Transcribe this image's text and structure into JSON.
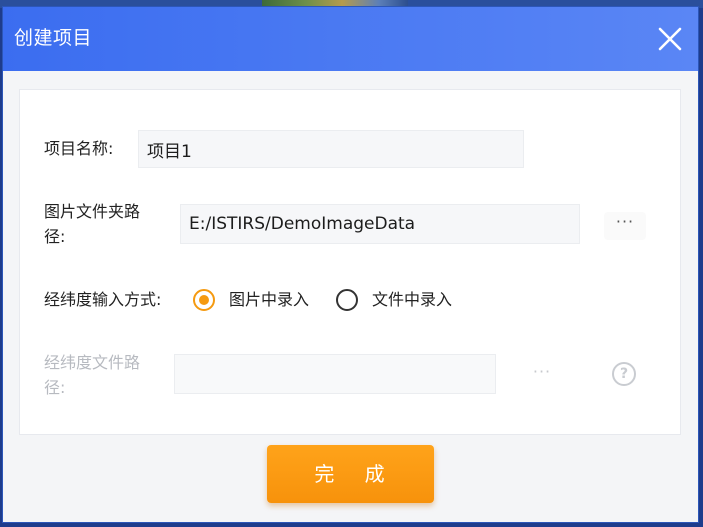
{
  "dialog": {
    "title": "创建项目",
    "done_label": "完 成"
  },
  "form": {
    "project_name": {
      "label": "项目名称:",
      "value": "项目1"
    },
    "image_folder": {
      "label_line1": "图片文件夹路",
      "label_line2": "径:",
      "value": "E:/ISTIRS/DemoImageData",
      "browse_label": "···"
    },
    "coord_input_method": {
      "label": "经纬度输入方式:",
      "options": [
        {
          "label": "图片中录入",
          "selected": true
        },
        {
          "label": "文件中录入",
          "selected": false
        }
      ]
    },
    "coord_file": {
      "label_line1": "经纬度文件路",
      "label_line2": "径:",
      "value": "",
      "browse_label": "···",
      "help_label": "?",
      "disabled": true
    }
  },
  "colors": {
    "title_bar": "#3b6df0",
    "accent": "#f59a10",
    "primary_button": "#ffa31a"
  },
  "icons": {
    "close": "close-icon",
    "help": "help-icon"
  }
}
